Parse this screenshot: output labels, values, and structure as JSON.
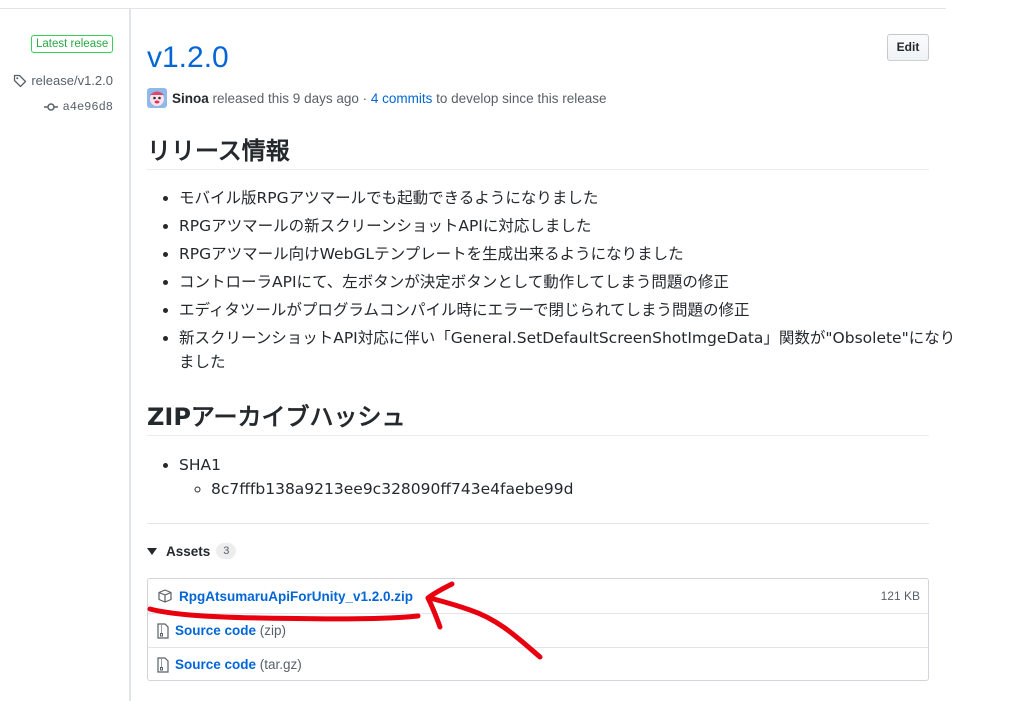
{
  "sidebar": {
    "badge": "Latest release",
    "tag": "release/v1.2.0",
    "commit": "a4e96d8"
  },
  "header": {
    "title": "v1.2.0",
    "edit_label": "Edit",
    "author": "Sinoa",
    "released_text": " released this 9 days ago · ",
    "commits_link": "4 commits",
    "to_text": " to develop since this release"
  },
  "notes": {
    "heading": "リリース情報",
    "items": [
      "モバイル版RPGアツマールでも起動できるようになりました",
      "RPGアツマールの新スクリーンショットAPIに対応しました",
      "RPGアツマール向けWebGLテンプレートを生成出来るようになりました",
      "コントローラAPIにて、左ボタンが決定ボタンとして動作してしまう問題の修正",
      "エディタツールがプログラムコンパイル時にエラーで閉じられてしまう問題の修正",
      "新スクリーンショットAPI対応に伴い「General.SetDefaultScreenShotImgeData」関数が\"Obsolete\"になりました"
    ]
  },
  "hash": {
    "heading": "ZIPアーカイブハッシュ",
    "algo": "SHA1",
    "value": "8c7fffb138a9213ee9c328090ff743e4faebe99d"
  },
  "assets": {
    "label": "Assets",
    "count": "3",
    "items": [
      {
        "name": "RpgAtsumaruApiForUnity_v1.2.0.zip",
        "suffix": "",
        "size": "121 KB",
        "icon": "package-icon"
      },
      {
        "name": "Source code",
        "suffix": "(zip)",
        "size": "",
        "icon": "file-zip-icon"
      },
      {
        "name": "Source code",
        "suffix": "(tar.gz)",
        "size": "",
        "icon": "file-zip-icon"
      }
    ]
  },
  "colors": {
    "link": "#0366d6",
    "badge_green": "#28a745",
    "annotation_red": "#e8000f"
  }
}
